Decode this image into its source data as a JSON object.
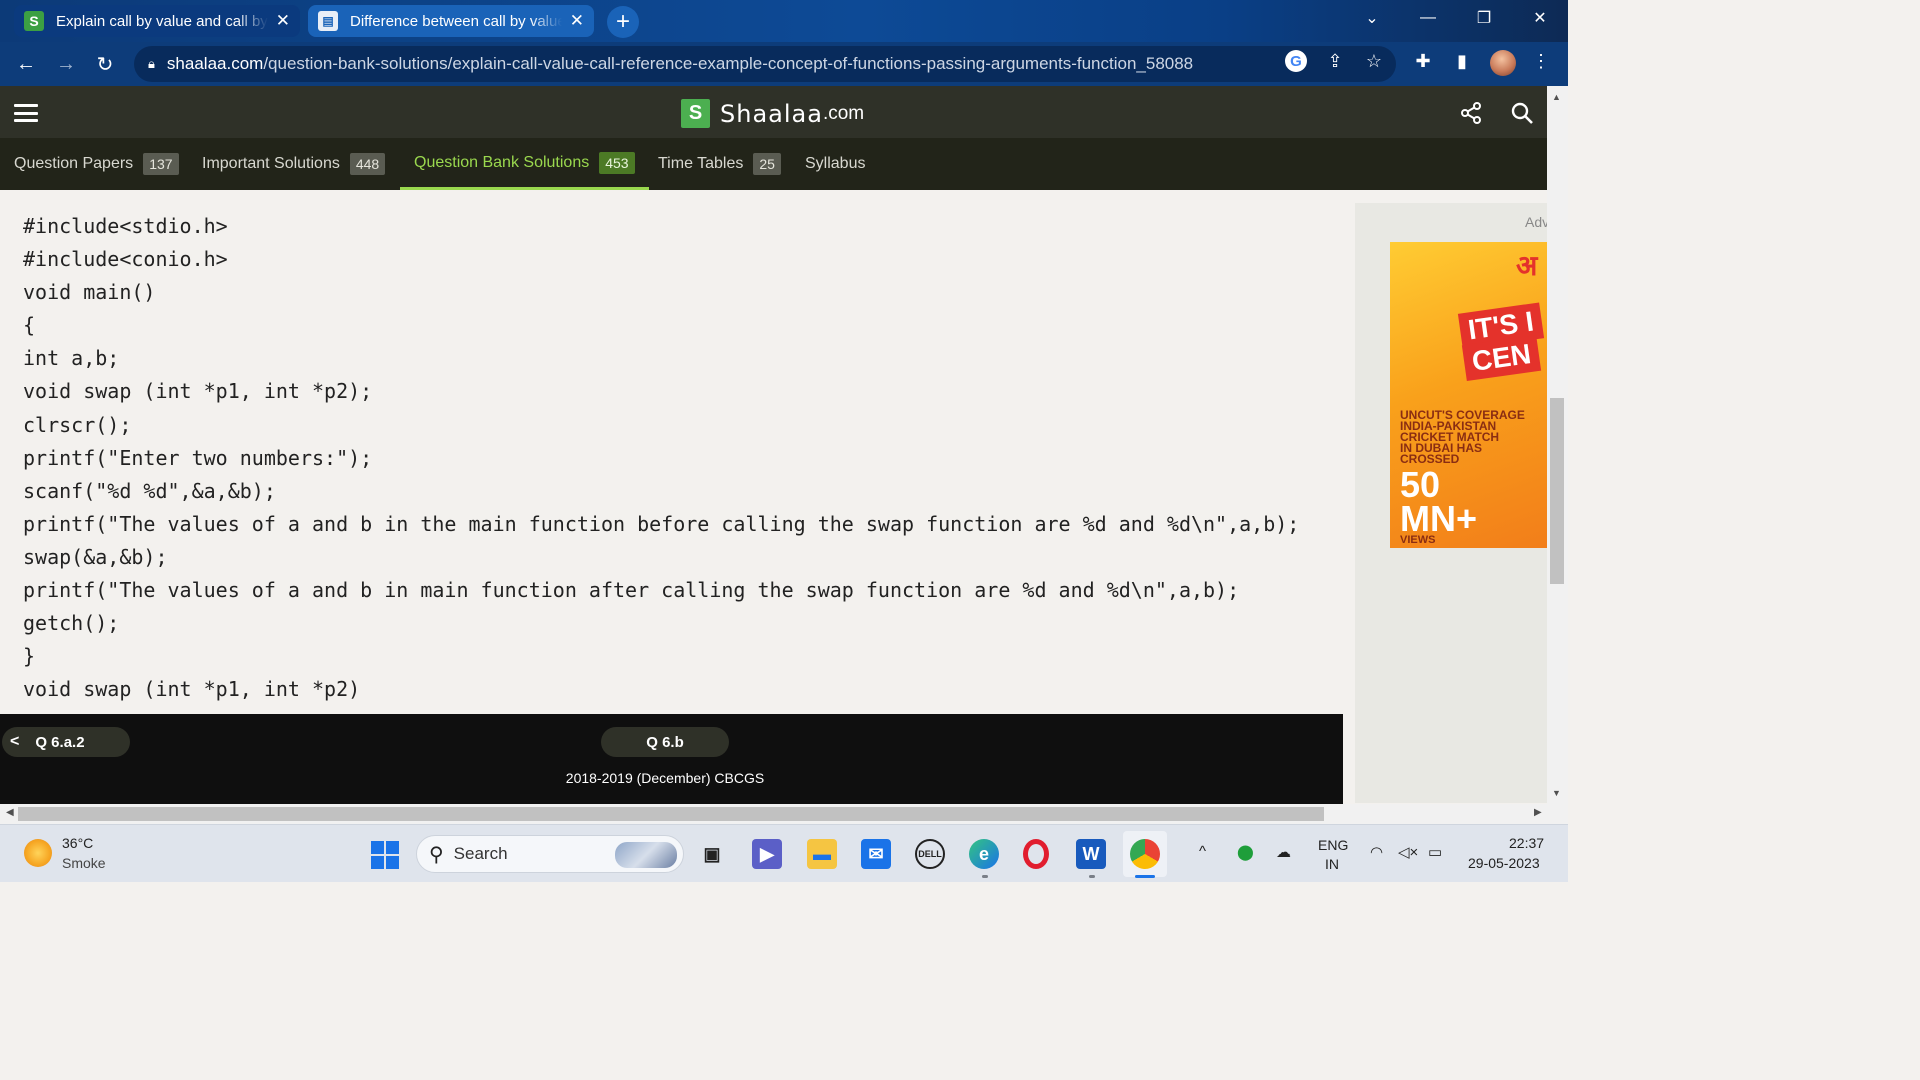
{
  "browser": {
    "tabs": [
      {
        "title": "Explain call by value and call by reference with an example.",
        "favicon": "S"
      },
      {
        "title": "Difference between call by value and call by reference"
      }
    ],
    "new_tab_label": "+",
    "url_domain": "shaalaa.com",
    "url_path": "/question-bank-solutions/explain-call-value-call-reference-example-concept-of-functions-passing-arguments-function_58088",
    "icons": {
      "back": "back-arrow-icon",
      "forward": "forward-arrow-icon",
      "reload": "reload-icon",
      "lock": "lock-icon",
      "google": "google-icon",
      "share": "share-icon",
      "star": "star-icon",
      "extensions": "puzzle-icon",
      "sidepanel": "side-panel-icon",
      "menu": "kebab-menu-icon"
    }
  },
  "site": {
    "logo_letter": "S",
    "logo_text": "Shaalaa",
    "logo_domain": ".com",
    "nav_tabs": [
      {
        "label": "Question Papers",
        "count": "137"
      },
      {
        "label": "Important Solutions",
        "count": "448"
      },
      {
        "label": "Question Bank Solutions",
        "count": "453"
      },
      {
        "label": "Time Tables",
        "count": "25"
      },
      {
        "label": "Syllabus",
        "count": ""
      }
    ],
    "active_tab": "Question Bank Solutions",
    "accent_color": "#9ad84e",
    "header_bg": "#2f3128"
  },
  "code": {
    "lines": [
      "#include<stdio.h>",
      "#include<conio.h>",
      "void main()",
      "{",
      "int a,b;",
      "void swap (int *p1, int *p2);",
      "clrscr();",
      "printf(\"Enter two numbers:\");",
      "scanf(\"%d %d\",&a,&b);",
      "printf(\"The values of a and b in the main function before calling the swap function are %d and %d\\n\",a,b);",
      "swap(&a,&b);",
      "printf(\"The values of a and b in main function after calling the swap function are %d and %d\\n\",a,b);",
      "getch();",
      "}",
      "void swap (int *p1, int *p2)"
    ]
  },
  "ad": {
    "label": "Adv",
    "hindi": "अ",
    "headline1": "IT'S I",
    "headline2": "CEN",
    "line1": "UNCUT'S COVERAGE",
    "line2": "INDIA-PAKISTAN",
    "line3": "CRICKET MATCH",
    "line4": "IN DUBAI HAS",
    "line5": "CROSSED",
    "big1": "50",
    "big2": "MN+",
    "views": "VIEWS"
  },
  "question_nav": {
    "prev_label": "Q 6.a.2",
    "current_label": "Q 6.b",
    "paper": "2018-2019 (December) CBCGS"
  },
  "taskbar": {
    "temperature": "36°C",
    "weather": "Smoke",
    "search_placeholder": "Search",
    "lang_line1": "ENG",
    "lang_line2": "IN",
    "time": "22:37",
    "date": "29-05-2023",
    "apps": [
      "windows-start-icon",
      "task-view-icon",
      "teams-icon",
      "file-explorer-icon",
      "mail-icon",
      "dell-icon",
      "edge-icon",
      "opera-icon",
      "word-icon",
      "chrome-icon"
    ]
  }
}
